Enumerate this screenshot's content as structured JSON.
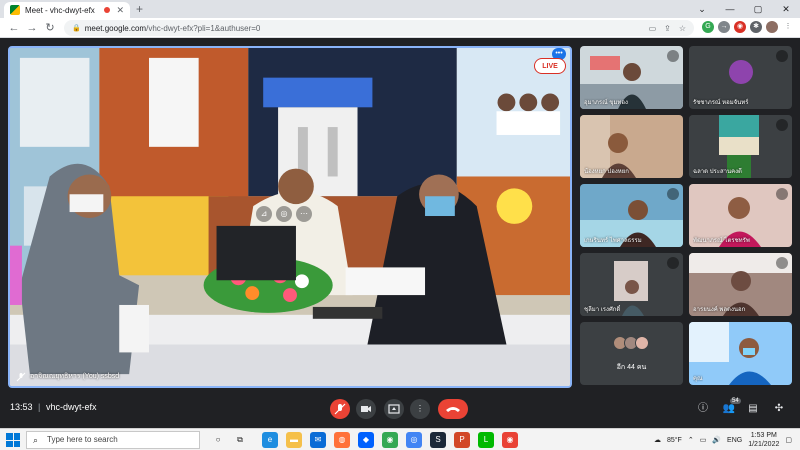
{
  "browser": {
    "tab_title": "Meet - vhc-dwyt-efx",
    "url_host": "meet.google.com",
    "url_path": "/vhc-dwyt-efx?pli=1&authuser=0"
  },
  "main": {
    "live_label": "LIVE",
    "presenter_name": "อาจิณณยุทธิหาร (You) ssbsd"
  },
  "participants": [
    {
      "name": "อุมาภรณ์ ขุมทอง",
      "muted": true
    },
    {
      "name": "รัชชาภรณ์ หอมจันทร์",
      "muted": true
    },
    {
      "name": "น้องหยก ปองหยก",
      "muted": false
    },
    {
      "name": "ฉลาด ประสานคงดี",
      "muted": true
    },
    {
      "name": "เกษรินทร์ ไพศาลธรรม",
      "muted": true
    },
    {
      "name": "พัฒนาภรณ์ โตรชทรัพ",
      "muted": true
    },
    {
      "name": "ชุลีมา เรงศักดิ์",
      "muted": true
    },
    {
      "name": "อารยนงค์ พลดงนอก",
      "muted": true
    },
    {
      "name": "อีก 44 คน",
      "muted": false
    },
    {
      "name": "คุณ",
      "muted": false
    }
  ],
  "controls": {
    "time": "13:53",
    "separator": "|",
    "meeting_code": "vhc-dwyt-efx",
    "people_count": "54"
  },
  "taskbar": {
    "search_placeholder": "Type here to search",
    "weather": "85°F",
    "language": "ENG",
    "clock_time": "1:53 PM",
    "clock_date": "1/21/2022"
  },
  "colors": {
    "accent": "#8ab4f8",
    "hangup": "#ea4335",
    "meet_bg": "#202124"
  }
}
